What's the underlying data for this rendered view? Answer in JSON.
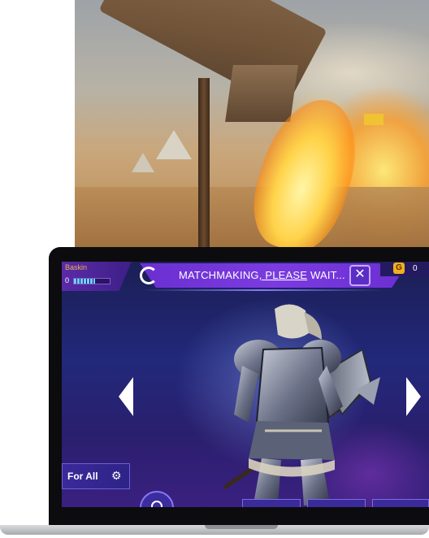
{
  "hud": {
    "player_name": "Baskin",
    "level": "0",
    "xp_fraction": 0.6
  },
  "matchmaking": {
    "status_before_underline": "MATCHMAKING",
    "status_underlined": ", PLEASE",
    "status_after": " WAIT...",
    "close_label": "✕"
  },
  "currency": {
    "coin_symbol": "G",
    "amount": "0"
  },
  "skin": {
    "label": "For All"
  },
  "icons": {
    "left_arrow": "chevron-left-icon",
    "right_arrow": "chevron-right-icon",
    "settings": "gear-icon",
    "close": "close-icon",
    "loading": "loading-ring-icon"
  },
  "colors": {
    "banner": "#7b3be0",
    "coin": "#f0b01e",
    "background": "#22287a"
  }
}
